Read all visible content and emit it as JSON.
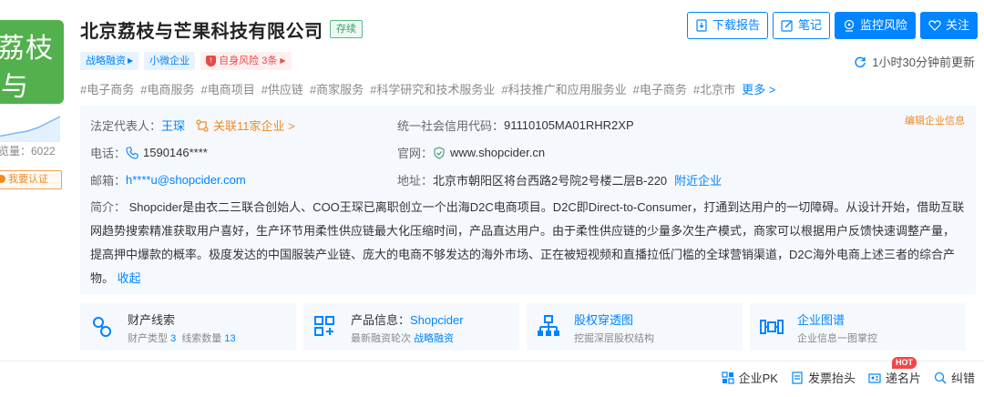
{
  "logo": {
    "line1": "荔枝",
    "line2": "与"
  },
  "sidebar": {
    "views": "览量：6022",
    "claim": "我要认证"
  },
  "company": {
    "name": "北京荔枝与芒果科技有限公司",
    "status": "存续"
  },
  "actions": {
    "download": "下载报告",
    "note": "笔记",
    "monitor": "监控风险",
    "follow": "关注"
  },
  "update_text": "1小时30分钟前更新",
  "tags": {
    "financing": "战略融资",
    "size": "小微企业",
    "risk": "自身风险 3条"
  },
  "hashtags": [
    "#电子商务",
    "#电商服务",
    "#电商项目",
    "#供应链",
    "#商家服务",
    "#科学研究和技术服务业",
    "#科技推广和应用服务业",
    "#电子商务",
    "#北京市"
  ],
  "hashtags_more": "更多 >",
  "info": {
    "edit": "编辑企业信息",
    "legal_label": "法定代表人：",
    "legal_value": "王琛",
    "related": "关联11家企业 >",
    "credit_label": "统一社会信用代码：",
    "credit_value": "91110105MA01RHR2XP",
    "phone_label": "电话：",
    "phone_value": "1590146****",
    "site_label": "官网：",
    "site_value": "www.shopcider.cn",
    "email_label": "邮箱：",
    "email_value": "h****u@shopcider.com",
    "addr_label": "地址：",
    "addr_value": "北京市朝阳区将台西路2号院2号楼二层B-220",
    "nearby": "附近企业",
    "intro_label": "简介：",
    "intro_text": "Shopcider是由衣二三联合创始人、COO王琛已离职创立一个出海D2C电商项目。D2C即Direct-to-Consumer，打通到达用户的一切障碍。从设计开始，借助互联网趋势搜索精准获取用户喜好，生产环节用柔性供应链最大化压缩时间，产品直达用户。由于柔性供应链的少量多次生产模式，商家可以根据用户反馈快速调整产量，提高押中爆款的概率。极度发达的中国服装产业链、庞大的电商不够发达的海外市场、正在被短视频和直播拉低门槛的全球营销渠道，D2C海外电商上述三者的综合产物。",
    "intro_fold": "收起"
  },
  "cards": [
    {
      "title": "财产线索",
      "sub_label1": "财产类型",
      "sub_value1": "3",
      "sub_label2": "线索数量",
      "sub_value2": "13"
    },
    {
      "title": "产品信息：",
      "title_link": "Shopcider",
      "sub_label1": "最新融资轮次",
      "sub_value1": "战略融资"
    },
    {
      "title": "股权穿透图",
      "sub": "挖掘深层股权结构"
    },
    {
      "title": "企业图谱",
      "sub": "企业信息一图掌控"
    }
  ],
  "footer": {
    "pk": "企业PK",
    "invoice": "发票抬头",
    "card": "递名片",
    "hot": "HOT",
    "correct": "纠错"
  },
  "colors": {
    "accent": "#0084ff",
    "logo": "#52b04d",
    "risk": "#e84a4a",
    "status": "#3a9d6b"
  }
}
